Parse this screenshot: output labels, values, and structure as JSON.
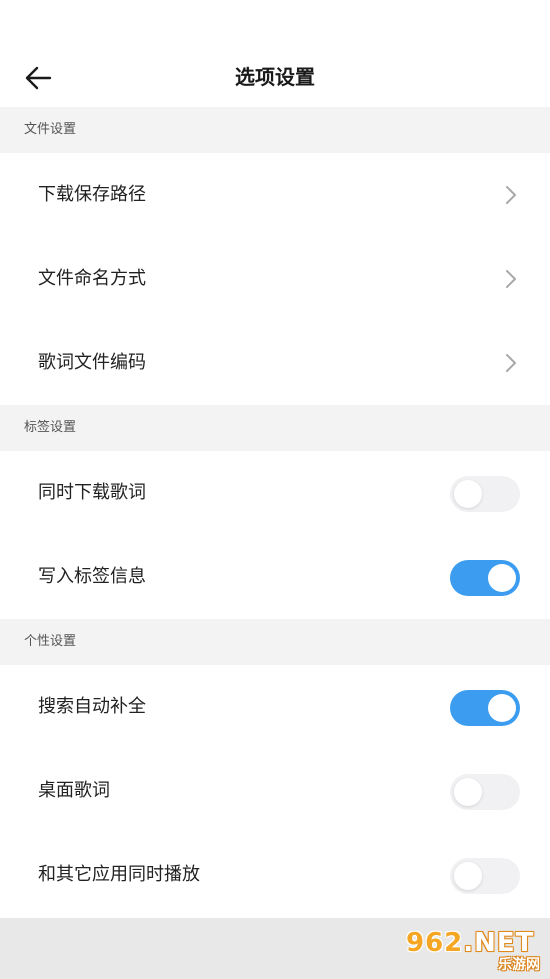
{
  "header": {
    "title": "选项设置",
    "back_icon": "arrow-left-icon"
  },
  "sections": [
    {
      "title": "文件设置",
      "items": [
        {
          "label": "下载保存路径",
          "control": "chevron"
        },
        {
          "label": "文件命名方式",
          "control": "chevron"
        },
        {
          "label": "歌词文件编码",
          "control": "chevron"
        }
      ]
    },
    {
      "title": "标签设置",
      "items": [
        {
          "label": "同时下载歌词",
          "control": "toggle",
          "on": false
        },
        {
          "label": "写入标签信息",
          "control": "toggle",
          "on": true
        }
      ]
    },
    {
      "title": "个性设置",
      "items": [
        {
          "label": "搜索自动补全",
          "control": "toggle",
          "on": true
        },
        {
          "label": "桌面歌词",
          "control": "toggle",
          "on": false
        },
        {
          "label": "和其它应用同时播放",
          "control": "toggle",
          "on": false
        }
      ]
    }
  ],
  "watermark": {
    "main_prefix": "962",
    "main_suffix": ".NET",
    "sub": "乐游网"
  },
  "colors": {
    "accent": "#3c9df0",
    "section_bg": "#f3f3f3",
    "toggle_off": "#f1f1f3"
  }
}
